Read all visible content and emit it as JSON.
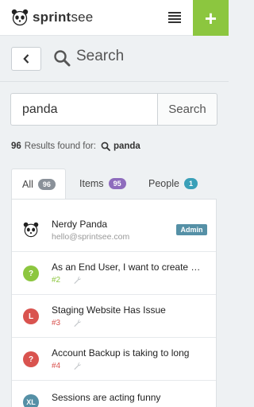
{
  "app": {
    "brand_bold": "sprint",
    "brand_light": "see",
    "add_label": "+"
  },
  "header": {
    "title": "Search"
  },
  "search": {
    "value": "panda",
    "button_label": "Search"
  },
  "results": {
    "count": "96",
    "found_label": "Results found for:",
    "term": "panda"
  },
  "tabs": [
    {
      "label": "All",
      "count": "96",
      "badge_color": "#8a9199"
    },
    {
      "label": "Items",
      "count": "95",
      "badge_color": "#8e6cbd"
    },
    {
      "label": "People",
      "count": "1",
      "badge_color": "#3aa0b8"
    }
  ],
  "person": {
    "name": "Nerdy Panda",
    "email": "hello@sprintsee.com",
    "role": "Admin"
  },
  "items": [
    {
      "title": "As an End User, I want to create …",
      "ref": "#2",
      "avatar": "?",
      "color": "#8cc63f"
    },
    {
      "title": "Staging Website Has Issue",
      "ref": "#3",
      "avatar": "L",
      "color": "#d9534f"
    },
    {
      "title": "Account Backup is taking to long",
      "ref": "#4",
      "avatar": "?",
      "color": "#d9534f"
    },
    {
      "title": "Sessions are acting funny",
      "ref": "",
      "avatar": "XL",
      "color": "#5590a6"
    }
  ]
}
